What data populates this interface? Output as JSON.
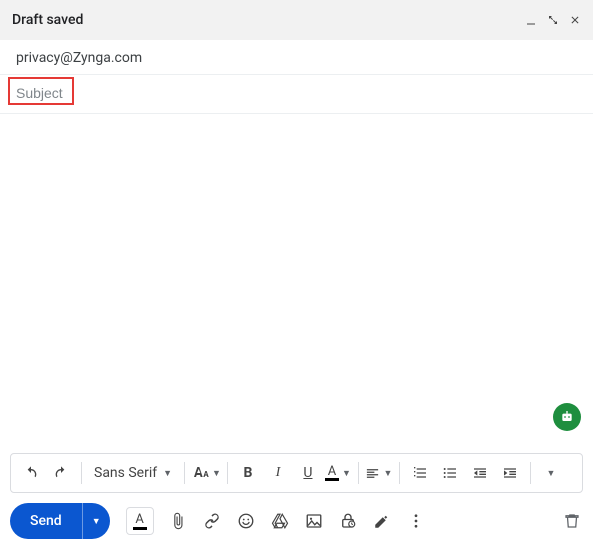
{
  "header": {
    "title": "Draft saved"
  },
  "recipients": {
    "to": "privacy@Zynga.com"
  },
  "subject": {
    "placeholder": "Subject",
    "value": ""
  },
  "formatToolbar": {
    "font": "Sans Serif",
    "buttons": {
      "bold": "B",
      "italic": "I",
      "underline": "U",
      "textColor": "A"
    }
  },
  "send": {
    "label": "Send"
  },
  "icons": {
    "minimize": "minimize-icon",
    "fullscreen": "fullscreen-icon",
    "close": "close-icon",
    "undo": "undo-icon",
    "redo": "redo-icon",
    "fontSize": "font-size-icon",
    "align": "align-icon",
    "numList": "numbered-list-icon",
    "bulList": "bulleted-list-icon",
    "indentLess": "indent-decrease-icon",
    "indentMore": "indent-increase-icon",
    "moreFormat": "more-formatting-icon",
    "textColor": "text-color-icon",
    "attach": "attach-icon",
    "link": "link-icon",
    "emoji": "emoji-icon",
    "drive": "drive-icon",
    "image": "image-icon",
    "confidential": "confidential-icon",
    "signature": "signature-icon",
    "moreOptions": "more-options-icon",
    "trash": "trash-icon",
    "assistant": "assistant-icon"
  }
}
